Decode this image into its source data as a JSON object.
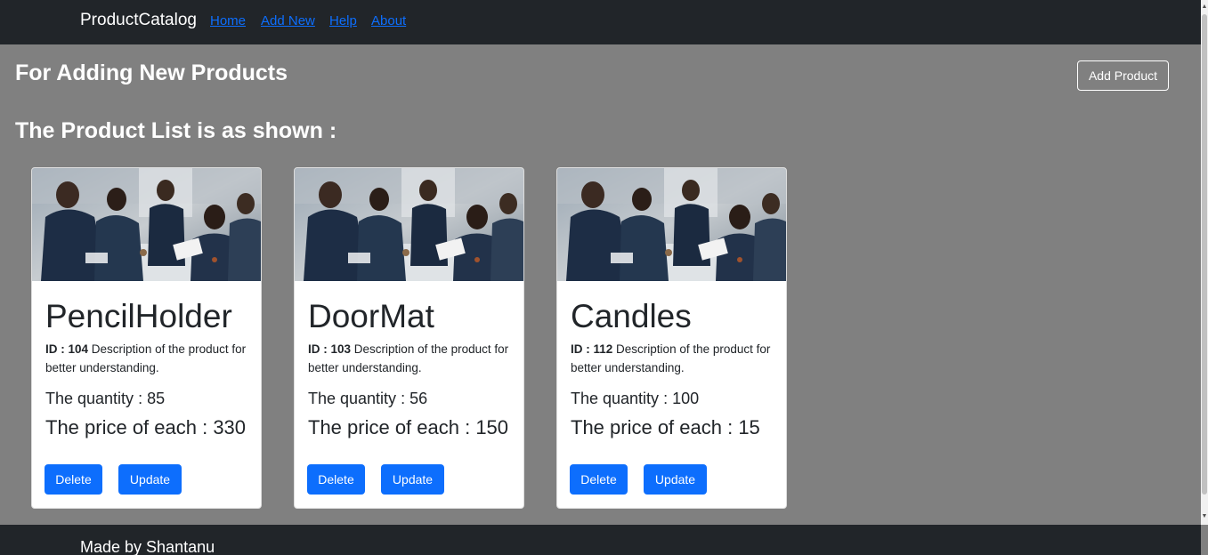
{
  "navbar": {
    "brand": "ProductCatalog",
    "links": [
      "Home",
      "Add New",
      "Help",
      "About"
    ]
  },
  "main": {
    "heading_add": "For Adding New Products",
    "add_button": "Add Product",
    "heading_list": "The Product List is as shown :"
  },
  "products": [
    {
      "name": "PencilHolder",
      "id_label": "ID : 104",
      "description": "Description of the product for better understanding.",
      "quantity": "The quantity : 85",
      "price": "The price of each : 330",
      "delete": "Delete",
      "update": "Update"
    },
    {
      "name": "DoorMat",
      "id_label": "ID : 103",
      "description": "Description of the product for better understanding.",
      "quantity": "The quantity : 56",
      "price": "The price of each : 150",
      "delete": "Delete",
      "update": "Update"
    },
    {
      "name": "Candles",
      "id_label": "ID : 112",
      "description": "Description of the product for better understanding.",
      "quantity": "The quantity : 100",
      "price": "The price of each : 15",
      "delete": "Delete",
      "update": "Update"
    }
  ],
  "footer": {
    "text": "Made by Shantanu"
  },
  "colors": {
    "navbar": "#212529",
    "background": "#808080",
    "primary": "#0d6efd"
  }
}
